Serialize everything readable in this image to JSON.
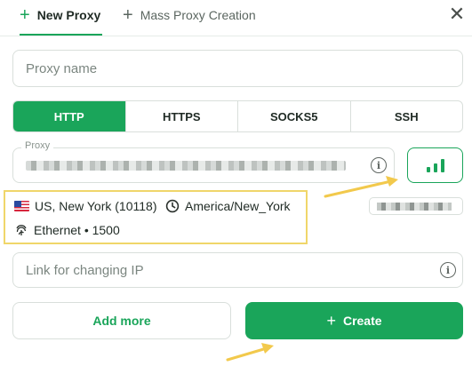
{
  "tabs": [
    {
      "label": "New Proxy",
      "icon": "plus-icon"
    },
    {
      "label": "Mass Proxy Creation",
      "icon": "plus-icon"
    }
  ],
  "close_icon": "close-icon",
  "form": {
    "proxy_name_placeholder": "Proxy name",
    "protocols": [
      "HTTP",
      "HTTPS",
      "SOCKS5",
      "SSH"
    ],
    "selected_protocol": "HTTP",
    "proxy_label": "Proxy",
    "link_placeholder": "Link for changing IP"
  },
  "geo": {
    "location": "US, New York (10118)",
    "timezone": "America/New_York",
    "connection": "Ethernet • 1500"
  },
  "buttons": {
    "add_more": "Add more",
    "create": "Create"
  },
  "colors": {
    "accent": "#1aa55a",
    "highlight": "#f0d66a",
    "arrow": "#f2c94c"
  }
}
